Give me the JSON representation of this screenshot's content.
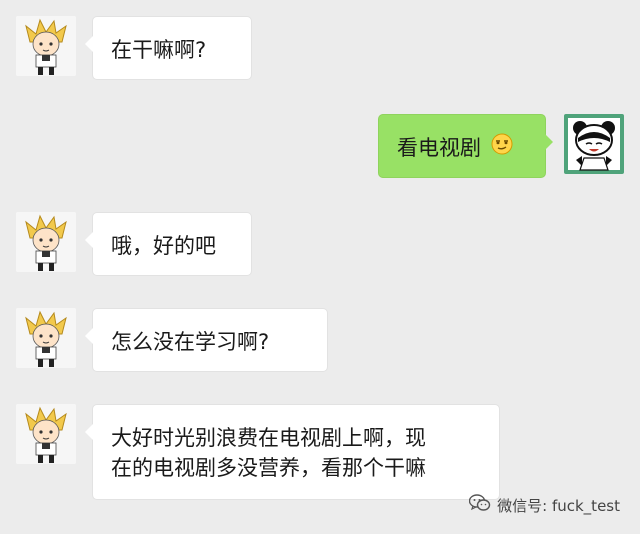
{
  "colors": {
    "background": "#ececec",
    "incoming_bubble": "#ffffff",
    "outgoing_bubble": "#98e165"
  },
  "messages": [
    {
      "side": "incoming",
      "text": "在干嘛啊?"
    },
    {
      "side": "outgoing",
      "text": "看电视剧",
      "emoji": "smirk-emoji-icon"
    },
    {
      "side": "incoming",
      "text": "哦，好的吧"
    },
    {
      "side": "incoming",
      "text": "怎么没在学习啊?"
    },
    {
      "side": "incoming",
      "lines": [
        "大好时光别浪费在电视剧上啊，现",
        "在的电视剧多没营养，看那个干嘛"
      ]
    }
  ],
  "watermark": {
    "icon": "wechat-icon",
    "text": "微信号: fuck_test"
  }
}
